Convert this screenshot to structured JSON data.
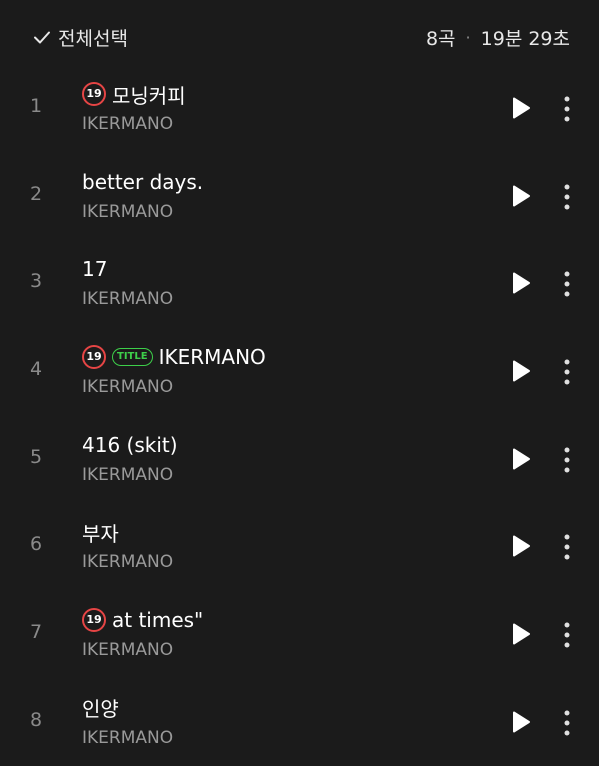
{
  "header": {
    "select_all_label": "전체선택",
    "track_count": "8곡",
    "separator": "·",
    "total_duration": "19분 29초"
  },
  "badges": {
    "explicit_label": "19",
    "title_label": "TITLE"
  },
  "colors": {
    "background": "#1b1b1b",
    "explicit_badge": "#e64545",
    "title_badge": "#3dcf4a"
  },
  "tracks": [
    {
      "number": "1",
      "title": "모닝커피",
      "artist": "IKERMANO",
      "explicit": true,
      "is_title": false
    },
    {
      "number": "2",
      "title": "better days.",
      "artist": "IKERMANO",
      "explicit": false,
      "is_title": false
    },
    {
      "number": "3",
      "title": "17",
      "artist": "IKERMANO",
      "explicit": false,
      "is_title": false
    },
    {
      "number": "4",
      "title": "IKERMANO",
      "artist": "IKERMANO",
      "explicit": true,
      "is_title": true
    },
    {
      "number": "5",
      "title": "416 (skit)",
      "artist": "IKERMANO",
      "explicit": false,
      "is_title": false
    },
    {
      "number": "6",
      "title": "부자",
      "artist": "IKERMANO",
      "explicit": false,
      "is_title": false
    },
    {
      "number": "7",
      "title": "at times\"",
      "artist": "IKERMANO",
      "explicit": true,
      "is_title": false
    },
    {
      "number": "8",
      "title": "인양",
      "artist": "IKERMANO",
      "explicit": false,
      "is_title": false
    }
  ],
  "icons": {
    "check": "check-icon",
    "play": "play-icon",
    "more": "more-vertical-icon"
  }
}
